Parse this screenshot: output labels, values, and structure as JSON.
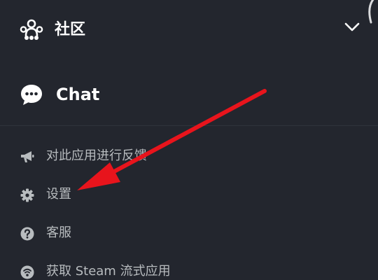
{
  "sidebar": {
    "community": {
      "label": "社区",
      "icon": "community-group-icon",
      "expand_icon": "chevron-down-icon"
    },
    "chat": {
      "label": "Chat",
      "icon": "chat-bubble-icon"
    },
    "menu_items": [
      {
        "label": "对此应用进行反馈",
        "icon": "megaphone-icon"
      },
      {
        "label": "设置",
        "icon": "gear-icon"
      },
      {
        "label": "客服",
        "icon": "question-circle-icon"
      },
      {
        "label": "获取 Steam 流式应用",
        "icon": "stream-icon"
      }
    ]
  },
  "colors": {
    "background": "#23262e",
    "primary_text": "#ffffff",
    "secondary_text": "#b8bcbf",
    "annotation": "#e8141c"
  }
}
